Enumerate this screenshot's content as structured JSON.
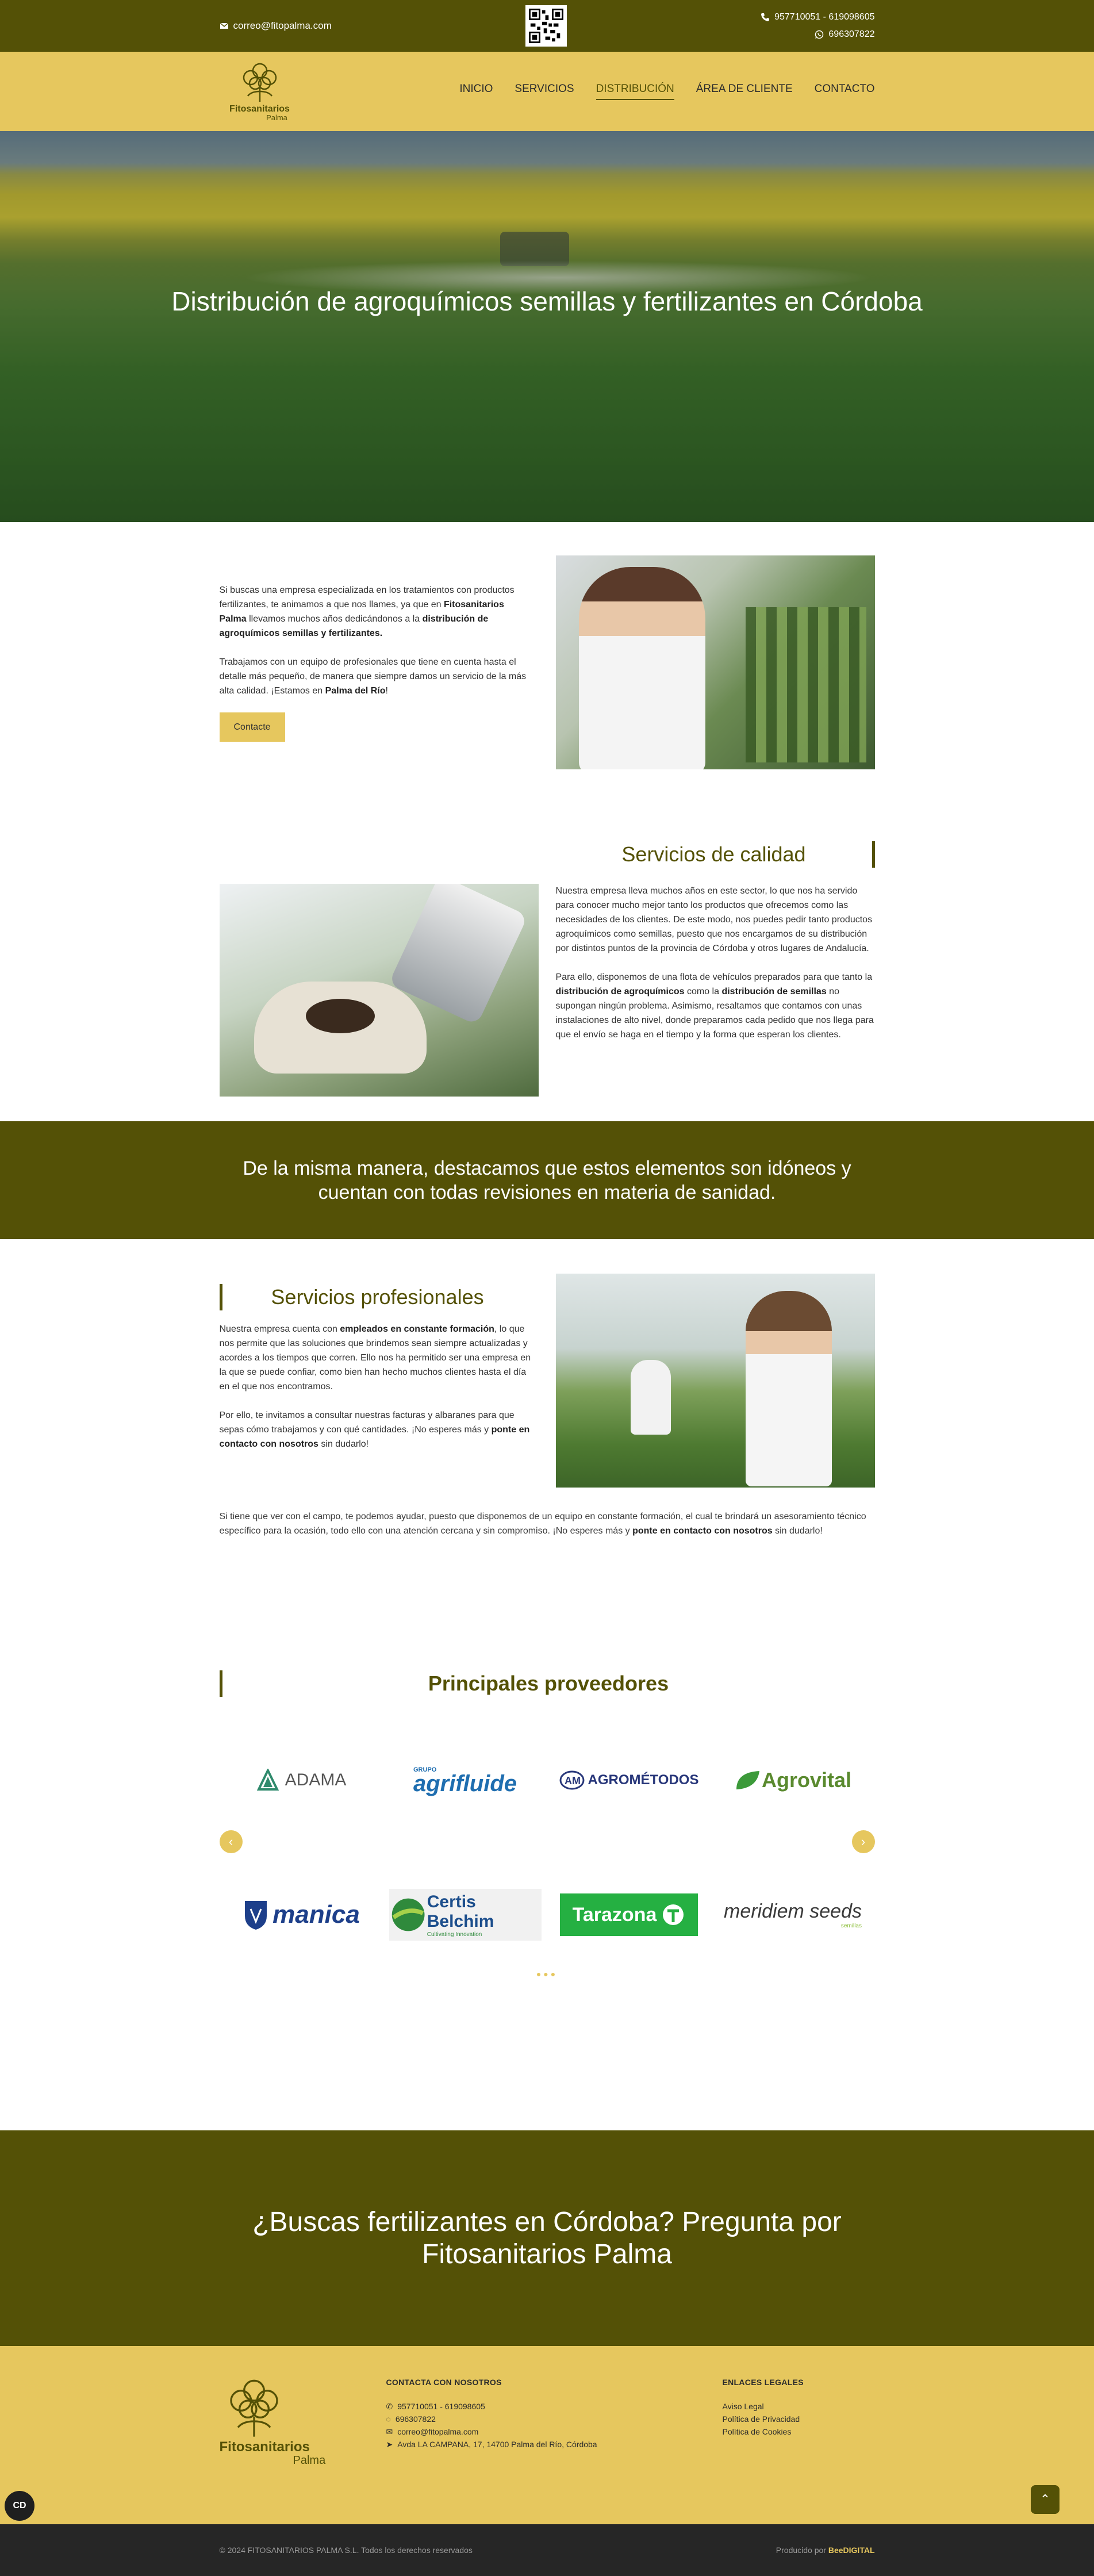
{
  "topbar": {
    "email": "correo@fitopalma.com",
    "phone_line1": "957710051 - 619098605",
    "phone_line2": "696307822"
  },
  "brand": {
    "name": "Fitosanitarios",
    "sub": "Palma",
    "accent": "#e6c75e",
    "dark": "#545106"
  },
  "nav": {
    "items": [
      {
        "label": "INICIO"
      },
      {
        "label": "SERVICIOS"
      },
      {
        "label": "DISTRIBUCIÓN"
      },
      {
        "label": "ÁREA DE CLIENTE"
      },
      {
        "label": "CONTACTO"
      }
    ],
    "active": "DISTRIBUCIÓN"
  },
  "hero": {
    "title": "Distribución de agroquímicos semillas y fertilizantes en Córdoba"
  },
  "intro": {
    "p1_a": "Si buscas una empresa especializada en los tratamientos con productos fertilizantes, te animamos a que nos llames, ya que en ",
    "p1_b": "Fitosanitarios Palma",
    "p1_c": " llevamos muchos años dedicándonos a la ",
    "p1_d": "distribución de agroquímicos semillas y fertilizantes.",
    "p2_a": "Trabajamos con un equipo de profesionales que tiene en cuenta hasta el detalle más pequeño, de manera que siempre damos un servicio de la más alta calidad. ¡Estamos en ",
    "p2_b": "Palma del Río",
    "p2_c": "!",
    "button": "Contacte"
  },
  "calidad": {
    "title": "Servicios de calidad",
    "p1": "Nuestra empresa lleva muchos años en este sector, lo que nos ha servido para conocer mucho mejor tanto los productos que ofrecemos como las necesidades de los clientes. De este modo, nos puedes pedir tanto productos agroquímicos como semillas, puesto que nos encargamos de su distribución por distintos puntos de la provincia de Córdoba y otros lugares de Andalucía.",
    "p2_a": "Para ello, disponemos de una flota de vehículos preparados para que tanto la ",
    "p2_b": "distribución de agroquímicos",
    "p2_c": " como la ",
    "p2_d": "distribución de semillas",
    "p2_e": " no supongan ningún problema. Asimismo, resaltamos que contamos con unas instalaciones de alto nivel, donde preparamos cada pedido que nos llega para que el envío se haga en el tiempo y la forma que esperan los clientes."
  },
  "banner": {
    "text": "De la misma manera, destacamos que estos elementos son idóneos y cuentan con todas revisiones en materia de sanidad."
  },
  "profesionales": {
    "title": "Servicios profesionales",
    "p1_a": "Nuestra empresa cuenta con ",
    "p1_b": "empleados en constante formación",
    "p1_c": ", lo que nos permite que las soluciones que brindemos sean siempre actualizadas y acordes a los tiempos que corren. Ello nos ha permitido ser una empresa en la que se puede confiar, como bien han hecho muchos clientes hasta el día en el que nos encontramos.",
    "p2_a": "Por ello, te invitamos a consultar nuestras facturas y albaranes para que sepas cómo trabajamos y con qué cantidades. ¡No esperes más y ",
    "p2_b": "ponte en contacto con nosotros",
    "p2_c": " sin dudarlo!",
    "full_a": "Si tiene que ver con el campo, te podemos ayudar, puesto que disponemos de un equipo en constante formación, el cual te brindará un asesoramiento técnico específico para la ocasión, todo ello con una atención cercana y sin compromiso. ¡No esperes más y ",
    "full_b": "ponte en contacto con nosotros",
    "full_c": " sin dudarlo!"
  },
  "proveedores": {
    "title": "Principales proveedores",
    "row1": [
      "ADAMA",
      "agrifluide",
      "AGROMÉTODOS",
      "Agrovital"
    ],
    "row1_prefix": "GRUPO",
    "row2": [
      "manica",
      "Certis Belchim",
      "Tarazona",
      "meridiem seeds"
    ],
    "certis_tagline": "Cultivating Innovation",
    "meridiem_tagline": "semillas"
  },
  "cta": {
    "title": "¿Buscas fertilizantes en Córdoba? Pregunta por Fitosanitarios Palma"
  },
  "footer": {
    "contact_title": "CONTACTA CON NOSOTROS",
    "phone": "957710051 - 619098605",
    "whatsapp": "696307822",
    "email": "correo@fitopalma.com",
    "address": "Avda LA CAMPANA, 17, 14700 Palma del Río, Córdoba",
    "legal_title": "ENLACES LEGALES",
    "legal": [
      "Aviso Legal",
      "Política de Privacidad",
      "Política de Cookies"
    ]
  },
  "bottom": {
    "copyright": "© 2024 FITOSANITARIOS PALMA S.L. Todos los derechos reservados",
    "produced_by": "Producido por ",
    "produced_brand": "BeeDIGITAL",
    "cookie_badge": "CD"
  }
}
